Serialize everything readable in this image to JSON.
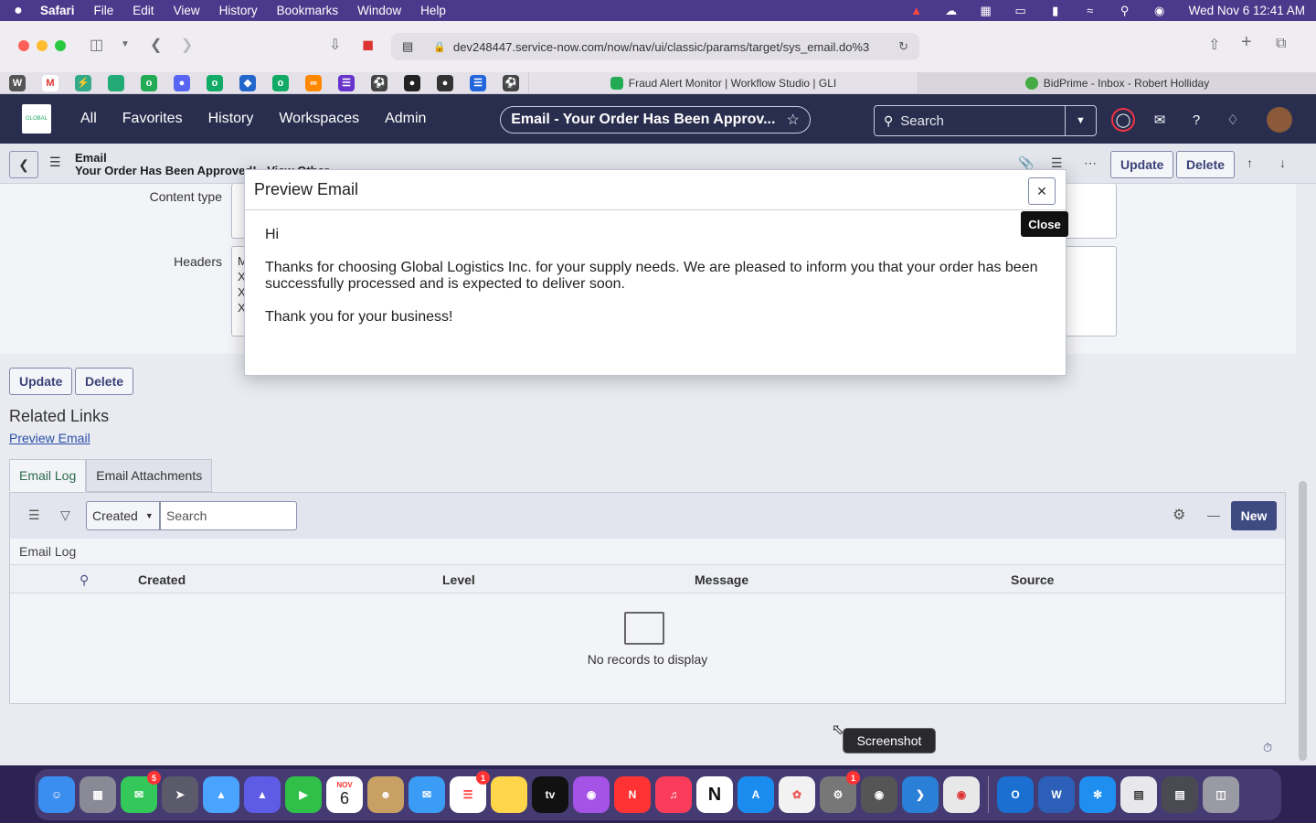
{
  "menubar": {
    "app": "Safari",
    "items": [
      "File",
      "Edit",
      "View",
      "History",
      "Bookmarks",
      "Window",
      "Help"
    ],
    "clock": "Wed Nov 6  12:41 AM"
  },
  "browser": {
    "url": "dev248447.service-now.com/now/nav/ui/classic/params/target/sys_email.do%3",
    "tabs": [
      {
        "label": "Fraud Alert Monitor | Workflow Studio | GLI"
      },
      {
        "label": "BidPrime - Inbox - Robert Holliday"
      }
    ]
  },
  "sn_header": {
    "nav": [
      "All",
      "Favorites",
      "History",
      "Workspaces",
      "Admin"
    ],
    "title": "Email - Your Order Has Been Approv...",
    "search_placeholder": "Search"
  },
  "record": {
    "type": "Email",
    "name": "Your Order Has Been Approved! - View Other",
    "update_label": "Update",
    "delete_label": "Delete"
  },
  "form": {
    "content_type_label": "Content type",
    "headers_label": "Headers",
    "header_lines": [
      "M",
      "X",
      "X",
      "X"
    ]
  },
  "actions": {
    "update": "Update",
    "delete": "Delete"
  },
  "related_links": {
    "title": "Related Links",
    "preview_email": "Preview Email"
  },
  "sections": {
    "tabs": [
      "Email Log",
      "Email Attachments"
    ]
  },
  "list": {
    "filter_field": "Created",
    "search_placeholder": "Search",
    "new_label": "New",
    "title": "Email Log",
    "columns": [
      "Created",
      "Level",
      "Message",
      "Source"
    ],
    "empty_text": "No records to display"
  },
  "modal": {
    "title": "Preview Email",
    "body": [
      "Hi",
      "Thanks for choosing Global Logistics Inc. for your supply needs. We are pleased to inform you that your order has been successfully processed and is expected to deliver soon.",
      "Thank you for your business!"
    ],
    "close_tooltip": "Close"
  },
  "dock": {
    "tooltip": "Screenshot",
    "badges": {
      "messages": "5",
      "reminders": "1",
      "settings": "1"
    },
    "calendar_month": "NOV",
    "calendar_day": "6"
  }
}
